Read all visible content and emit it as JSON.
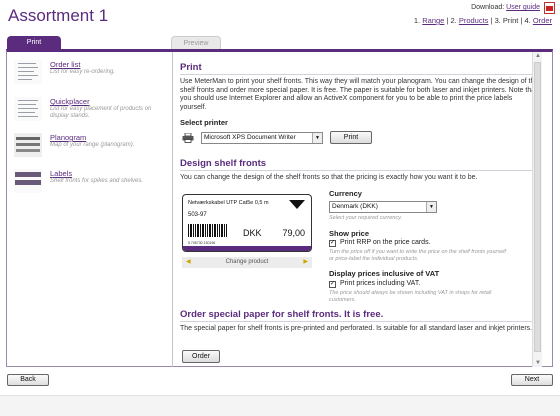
{
  "header": {
    "title": "Assortment 1",
    "download_label": "Download:",
    "user_guide": "User guide",
    "steps": [
      {
        "num": "1.",
        "label": "Range",
        "link": true
      },
      {
        "num": "2.",
        "label": "Products",
        "link": true
      },
      {
        "num": "3.",
        "label": "Print",
        "link": false
      },
      {
        "num": "4.",
        "label": "Order",
        "link": true
      }
    ]
  },
  "tabs": {
    "print": "Print",
    "preview": "Preview"
  },
  "sidebar": {
    "items": [
      {
        "title": "Order list",
        "desc": "List for easy re-ordering."
      },
      {
        "title": "Quickplacer",
        "desc": "List for easy placement of products on display stands."
      },
      {
        "title": "Planogram",
        "desc": "Map of your range (planogram)."
      },
      {
        "title": "Labels",
        "desc": "Shelf fronts for spikes and shelves."
      }
    ]
  },
  "print": {
    "heading": "Print",
    "intro": "Use MeterMan to print your shelf fronts. This way they will match your planogram. You can change the design of the shelf fronts and order more special paper. It is free. The paper is suitable for both laser and inkjet printers. Note that you should use Internet Explorer and allow an ActiveX component for you to be able to print the price labels yourself.",
    "select_printer_label": "Select printer",
    "printer_value": "Microsoft XPS Document Writer",
    "print_button": "Print"
  },
  "design": {
    "heading": "Design shelf fronts",
    "intro": "You can change the design of the shelf fronts so that the pricing is exactly how you want it to be.",
    "label": {
      "product_name": "Netværkskabel UTP Cat5e 0,5 m",
      "product_code": "503-97",
      "barcode_number": "5 705730 130196",
      "currency": "DKK",
      "price": "79,00"
    },
    "change_product": "Change product",
    "currency_label": "Currency",
    "currency_value": "Denmark (DKK)",
    "currency_hint": "Select your required currency.",
    "show_price_label": "Show price",
    "show_price_checkbox": "Print RRP on the price cards.",
    "show_price_checked": true,
    "show_price_hint": "Turn the price off if you want to write the price on the shelf fronts yourself or price-label the individual products.",
    "vat_label": "Display prices inclusive of VAT",
    "vat_checkbox": "Print prices including VAT.",
    "vat_checked": true,
    "vat_hint": "The price should always be shown including VAT in shops for retail customers."
  },
  "order": {
    "heading": "Order special paper for shelf fronts. It is free.",
    "text": "The special paper for shelf fronts is pre-printed and perforated. Is suitable for all standard laser and inkjet printers.",
    "button": "Order"
  },
  "footer": {
    "back": "Back",
    "next": "Next"
  },
  "colors": {
    "accent": "#5b2c7e",
    "price_bar": "#5b2c7e"
  }
}
